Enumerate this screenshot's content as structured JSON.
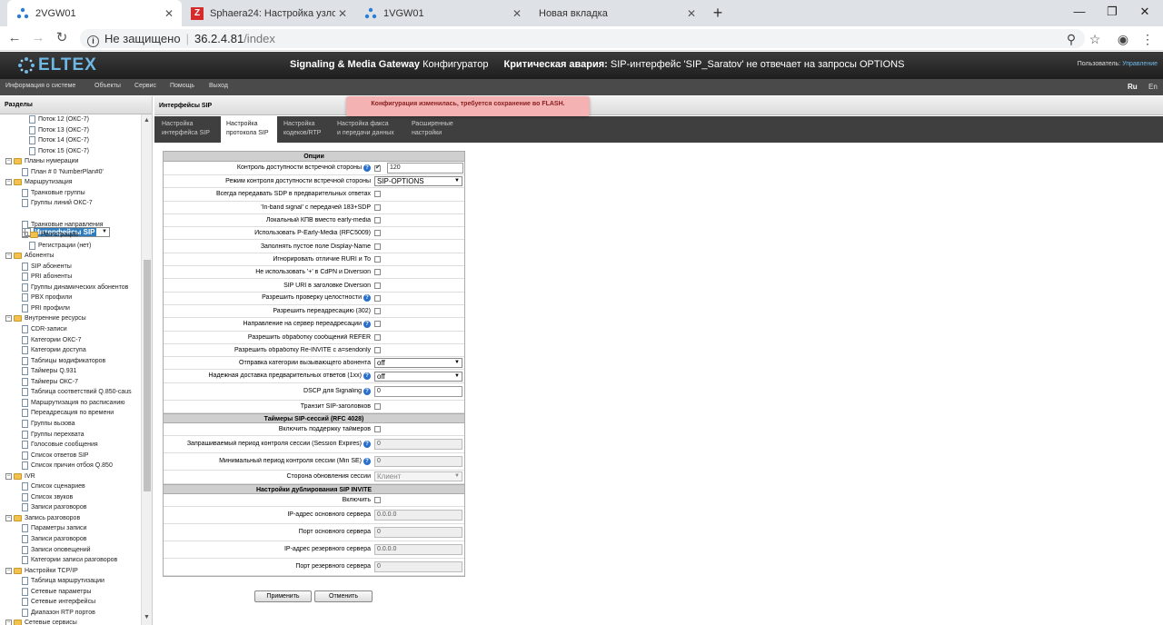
{
  "browser": {
    "tabs": [
      {
        "title": "2VGW01",
        "icon": "eltex-icon"
      },
      {
        "title": "Sphaera24: Настройка узлов сет",
        "icon": "z-icon"
      },
      {
        "title": "1VGW01",
        "icon": "eltex-icon"
      },
      {
        "title": "Новая вкладка",
        "icon": ""
      }
    ],
    "security": "Не защищено",
    "host": "36.2.4.81",
    "path": "/index"
  },
  "app": {
    "logo": "ELTEX",
    "title_bold": "Signaling & Media Gateway",
    "title_rest": "Конфигуратор",
    "alarm_label": "Критическая авария:",
    "alarm_text": "SIP-интерфейс 'SIP_Saratov' не отвечает на запросы OPTIONS",
    "user_label": "Пользователь:",
    "user_name": "Управление"
  },
  "menu": {
    "items": [
      "Информация о системе",
      "Объекты",
      "Сервис",
      "Помощь",
      "Выход"
    ],
    "lang_ru": "Ru",
    "lang_en": "En"
  },
  "sidebar": {
    "title": "Разделы",
    "nodes": [
      {
        "label": "Поток 12 (ОКС-7)",
        "kind": "doc",
        "level": 3
      },
      {
        "label": "Поток 13 (ОКС-7)",
        "kind": "doc",
        "level": 3
      },
      {
        "label": "Поток 14 (ОКС-7)",
        "kind": "doc",
        "level": 3
      },
      {
        "label": "Поток 15 (ОКС-7)",
        "kind": "doc",
        "level": 3
      },
      {
        "label": "Планы нумерации",
        "kind": "folder",
        "level": 1
      },
      {
        "label": "План # 0 'NumberPlan#0'",
        "kind": "doc",
        "level": 2
      },
      {
        "label": "Маршрутизация",
        "kind": "folder",
        "level": 1
      },
      {
        "label": "Транковые группы",
        "kind": "doc",
        "level": 2
      },
      {
        "label": "Группы линий ОКС-7",
        "kind": "doc",
        "level": 2
      },
      {
        "label": "Интерфейсы SIP",
        "kind": "doc",
        "level": 2,
        "selected": true
      },
      {
        "label": "Транковые направления",
        "kind": "doc",
        "level": 2
      },
      {
        "label": "Регистрация",
        "kind": "folder",
        "level": 2
      },
      {
        "label": "Регистрации (нет)",
        "kind": "doc",
        "level": 3
      },
      {
        "label": "Абоненты",
        "kind": "folder",
        "level": 1
      },
      {
        "label": "SIP абоненты",
        "kind": "doc",
        "level": 2
      },
      {
        "label": "PRI абоненты",
        "kind": "doc",
        "level": 2
      },
      {
        "label": "Группы динамических абонентов",
        "kind": "doc",
        "level": 2
      },
      {
        "label": "PBX профили",
        "kind": "doc",
        "level": 2
      },
      {
        "label": "PRI профили",
        "kind": "doc",
        "level": 2
      },
      {
        "label": "Внутренние ресурсы",
        "kind": "folder",
        "level": 1
      },
      {
        "label": "CDR-записи",
        "kind": "doc",
        "level": 2
      },
      {
        "label": "Категории ОКС-7",
        "kind": "doc",
        "level": 2
      },
      {
        "label": "Категории доступа",
        "kind": "doc",
        "level": 2
      },
      {
        "label": "Таблицы модификаторов",
        "kind": "doc",
        "level": 2
      },
      {
        "label": "Таймеры Q.931",
        "kind": "doc",
        "level": 2
      },
      {
        "label": "Таймеры ОКС-7",
        "kind": "doc",
        "level": 2
      },
      {
        "label": "Таблица соответствий Q.850-caus",
        "kind": "doc",
        "level": 2
      },
      {
        "label": "Маршрутизация по расписанию",
        "kind": "doc",
        "level": 2
      },
      {
        "label": "Переадресация по времени",
        "kind": "doc",
        "level": 2
      },
      {
        "label": "Группы вызова",
        "kind": "doc",
        "level": 2
      },
      {
        "label": "Группы перехвата",
        "kind": "doc",
        "level": 2
      },
      {
        "label": "Голосовые сообщения",
        "kind": "doc",
        "level": 2
      },
      {
        "label": "Список ответов SIP",
        "kind": "doc",
        "level": 2
      },
      {
        "label": "Список причин отбоя Q.850",
        "kind": "doc",
        "level": 2
      },
      {
        "label": "IVR",
        "kind": "folder",
        "level": 1
      },
      {
        "label": "Список сценариев",
        "kind": "doc",
        "level": 2
      },
      {
        "label": "Список звуков",
        "kind": "doc",
        "level": 2
      },
      {
        "label": "Записи разговоров",
        "kind": "doc",
        "level": 2
      },
      {
        "label": "Запись разговоров",
        "kind": "folder",
        "level": 1
      },
      {
        "label": "Параметры записи",
        "kind": "doc",
        "level": 2
      },
      {
        "label": "Записи разговоров",
        "kind": "doc",
        "level": 2
      },
      {
        "label": "Записи оповещений",
        "kind": "doc",
        "level": 2
      },
      {
        "label": "Категории записи разговоров",
        "kind": "doc",
        "level": 2
      },
      {
        "label": "Настройки TCP/IP",
        "kind": "folder",
        "level": 1
      },
      {
        "label": "Таблица маршрутизации",
        "kind": "doc",
        "level": 2
      },
      {
        "label": "Сетевые параметры",
        "kind": "doc",
        "level": 2
      },
      {
        "label": "Сетевые интерфейсы",
        "kind": "doc",
        "level": 2
      },
      {
        "label": "Диапазон RTP портов",
        "kind": "doc",
        "level": 2
      },
      {
        "label": "Сетевые сервисы",
        "kind": "folder",
        "level": 1
      }
    ]
  },
  "main": {
    "title": "Интерфейсы SIP",
    "notice": "Конфигурация изменилась, требуется сохранение во FLASH.",
    "subtabs": [
      {
        "line1": "Настройка",
        "line2": "интерфейса SIP"
      },
      {
        "line1": "Настройка",
        "line2": "протокола SIP",
        "active": true
      },
      {
        "line1": "Настройка",
        "line2": "кодеков/RTP"
      },
      {
        "line1": "Настройка факса",
        "line2": "и передачи данных"
      },
      {
        "line1": "Расширенные",
        "line2": "настройки"
      }
    ],
    "sections": {
      "options": "Опции",
      "timers": "Таймеры SIP-сессий (RFC 4028)",
      "dup": "Настройки дублирования SIP INVITE"
    },
    "options": [
      {
        "label": "Контроль доступности встречной стороны",
        "type": "cb_text",
        "checked": true,
        "value": "120",
        "help": true
      },
      {
        "label": "Режим контроля доступности встречной стороны",
        "type": "select",
        "value": "SIP-OPTIONS"
      },
      {
        "label": "Всегда передавать SDP в предварительных ответах",
        "type": "cb"
      },
      {
        "label": "'In-band signal' с передачей 183+SDP",
        "type": "cb"
      },
      {
        "label": "Локальный КПВ вместо early-media",
        "type": "cb"
      },
      {
        "label": "Использовать P-Early-Media (RFC5009)",
        "type": "cb"
      },
      {
        "label": "Заполнять пустое поле Display-Name",
        "type": "cb"
      },
      {
        "label": "Игнорировать отличие RURI и To",
        "type": "cb"
      },
      {
        "label": "Не использовать '+' в CdPN и Diversion",
        "type": "cb"
      },
      {
        "label": "SIP URI в заголовке Diversion",
        "type": "cb"
      },
      {
        "label": "Разрешить проверку целостности",
        "type": "cb",
        "help": true
      },
      {
        "label": "Разрешить переадресацию (302)",
        "type": "cb"
      },
      {
        "label": "Направление на сервер переадресации",
        "type": "cb",
        "help": true
      },
      {
        "label": "Разрешить обработку сообщений REFER",
        "type": "cb"
      },
      {
        "label": "Разрешить обработку Re-INVITE с a=sendonly",
        "type": "cb"
      },
      {
        "label": "Отправка категории вызывающего абонента",
        "type": "select",
        "value": "off"
      },
      {
        "label": "Надежная доставка предварительных ответов (1xx)",
        "type": "select",
        "value": "off",
        "help": true
      },
      {
        "label": "DSCP для Signaling",
        "type": "text",
        "value": "0",
        "help": true
      },
      {
        "label": "Транзит SIP-заголовков",
        "type": "cb"
      }
    ],
    "timers": [
      {
        "label": "Включить поддержку таймеров",
        "type": "cb"
      },
      {
        "label": "Запрашиваемый период контроля сессии (Session Expires)",
        "type": "text_dis",
        "value": "0",
        "help": true
      },
      {
        "label": "Минимальный период контроля сессии (Min SE)",
        "type": "text_dis",
        "value": "0",
        "help": true
      },
      {
        "label": "Сторона обновления сессии",
        "type": "select_dis",
        "value": "Клиент"
      }
    ],
    "dup": [
      {
        "label": "Включить",
        "type": "cb"
      },
      {
        "label": "IP-адрес основного сервера",
        "type": "text_dis",
        "value": "0.0.0.0"
      },
      {
        "label": "Порт основного сервера",
        "type": "text_dis",
        "value": "0"
      },
      {
        "label": "IP-адрес резервного сервера",
        "type": "text_dis",
        "value": "0.0.0.0"
      },
      {
        "label": "Порт резервного сервера",
        "type": "text_dis",
        "value": "0"
      }
    ],
    "apply": "Применить",
    "cancel": "Отменить"
  }
}
